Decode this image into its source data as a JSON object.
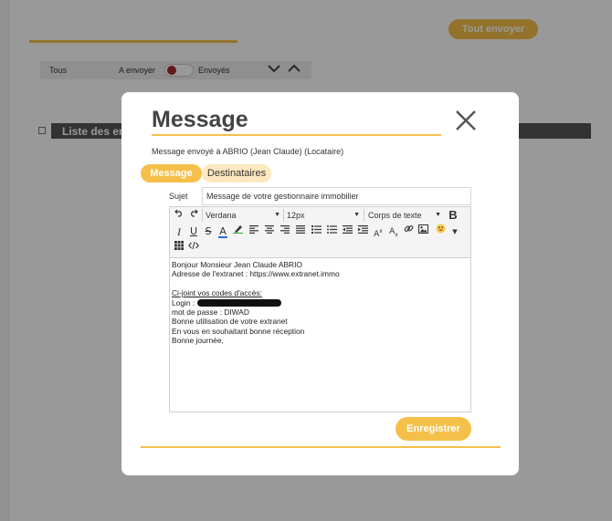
{
  "background": {
    "send_all_label": "Tout envoyer",
    "filters": {
      "all": "Tous",
      "to_send": "A envoyer",
      "sent": "Envoyés"
    },
    "list_header": "Liste des envois"
  },
  "modal": {
    "title": "Message",
    "recipient_info": "Message envoyé à ABRIO (Jean Claude) (Locataire)",
    "tabs": [
      {
        "label": "Message",
        "active": true
      },
      {
        "label": "Destinataires",
        "active": false
      }
    ],
    "subject": {
      "label": "Sujet",
      "value": "Message de votre gestionnaire immobilier"
    },
    "editor": {
      "font_family": "Verdana",
      "font_size": "12px",
      "block_format": "Corps de texte",
      "body_lines": [
        "Bonjour Monsieur Jean Claude ABRIO",
        "Adresse de l'extranet : https://www.extranet.immo",
        "",
        "Ci-joint vos codes d'accès:",
        "Login :",
        "mot de passe : DIWAD",
        "Bonne utilisation de votre extranet",
        "En vous en souhaitant bonne réception",
        "Bonne journée,"
      ]
    },
    "save_label": "Enregistrer"
  },
  "colors": {
    "accent": "#f5c04a",
    "accent_light": "#fde9bf",
    "text_color_swatch": "#2e6fd8",
    "highlight_swatch": "#3aa53a"
  }
}
